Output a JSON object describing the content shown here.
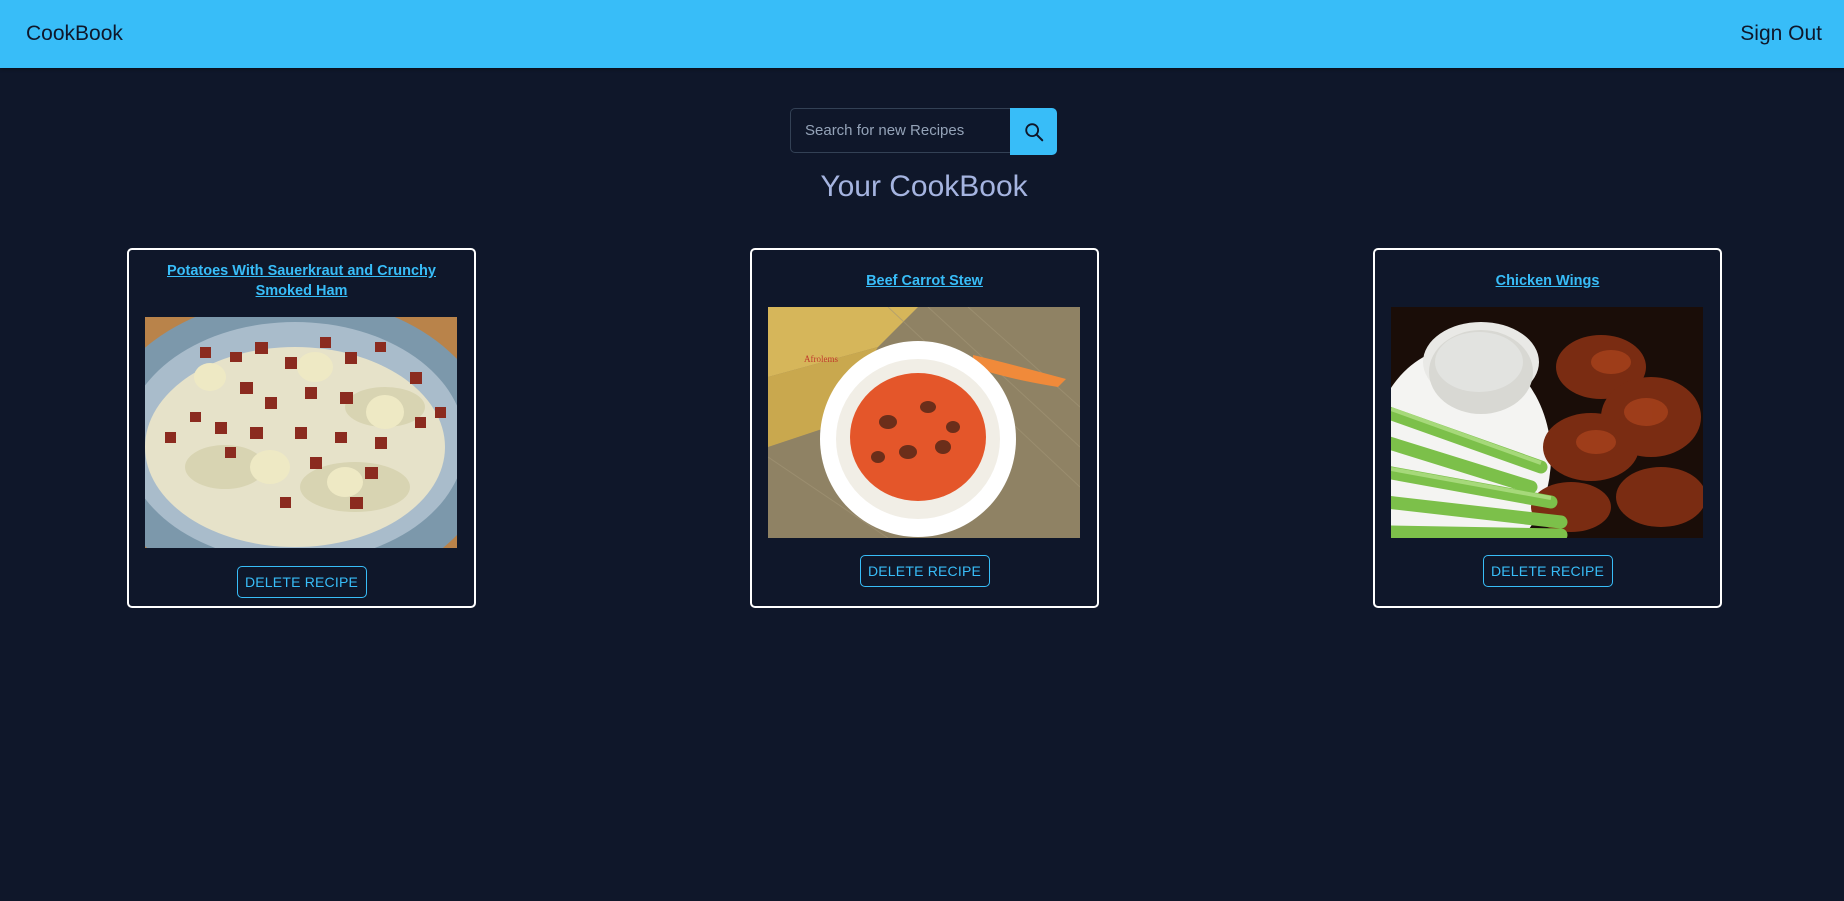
{
  "navbar": {
    "brand": "CookBook",
    "sign_out": "Sign Out"
  },
  "search": {
    "placeholder": "Search for new Recipes",
    "value": ""
  },
  "page": {
    "title": "Your CookBook"
  },
  "recipes": [
    {
      "title": "Potatoes With Sauerkraut and Crunchy Smoked Ham",
      "delete_label": "DELETE RECIPE"
    },
    {
      "title": "Beef Carrot Stew",
      "delete_label": "DELETE RECIPE",
      "image_watermark": "Afrolems"
    },
    {
      "title": "Chicken Wings",
      "delete_label": "DELETE RECIPE"
    }
  ],
  "colors": {
    "navbar": "#38bdf8",
    "background": "#0f172a",
    "accent": "#38bdf8",
    "title": "#a5b4e0"
  }
}
